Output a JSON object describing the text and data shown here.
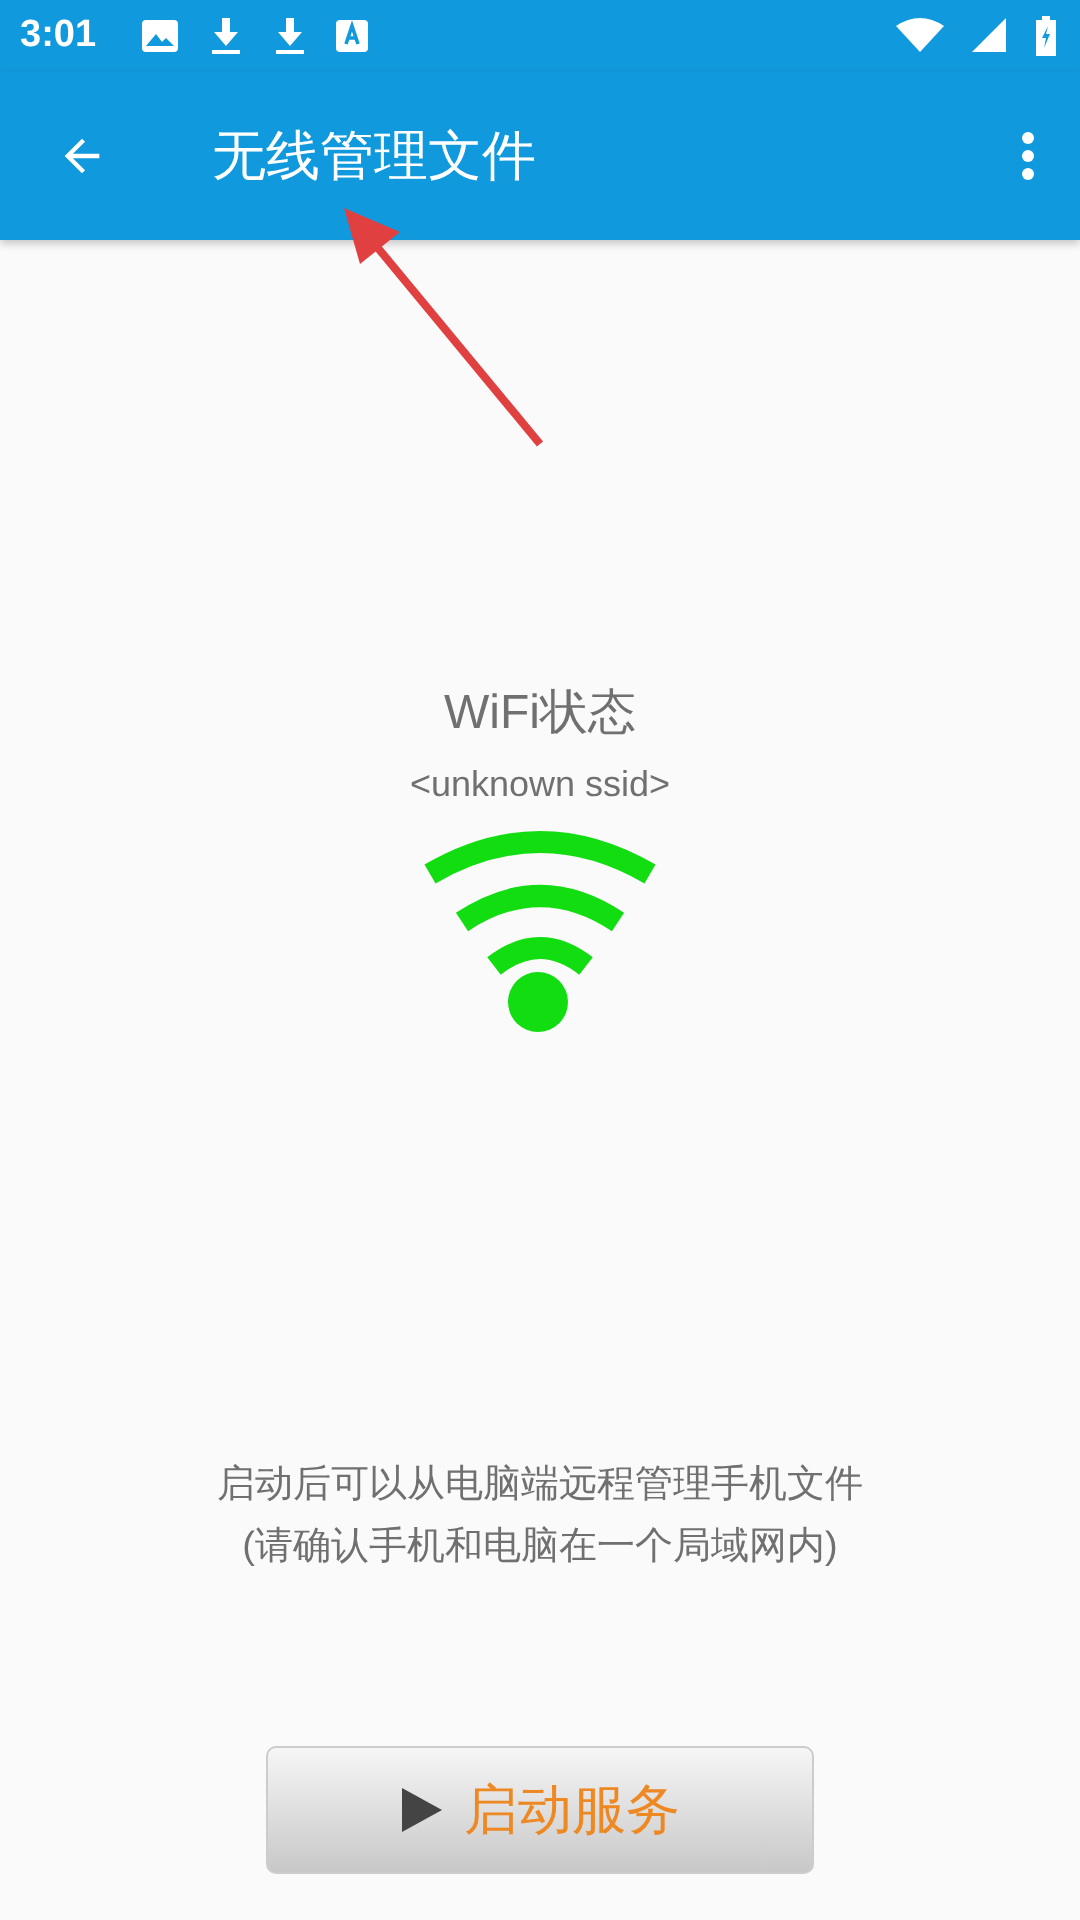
{
  "status_bar": {
    "time": "3:01"
  },
  "app_bar": {
    "title": "无线管理文件"
  },
  "wifi_status": {
    "title": "WiFi状态",
    "ssid": "<unknown ssid>"
  },
  "description": [
    "启动后可以从电脑端远程管理手机文件",
    "(请确认手机和电脑在一个局域网内)"
  ],
  "start_button": {
    "label": "启动服务"
  }
}
